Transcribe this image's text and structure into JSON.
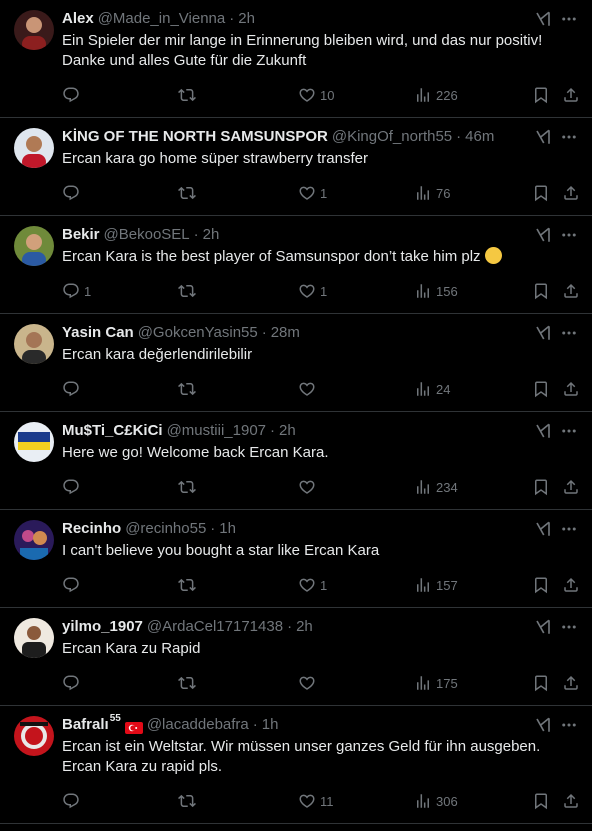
{
  "colors": {
    "background": "#000000",
    "text": "#e7e9ea",
    "muted": "#71767b",
    "divider": "#2f3336"
  },
  "icons": {
    "reply": "reply-icon",
    "retweet": "retweet-icon",
    "like": "heart-icon",
    "views": "views-icon",
    "bookmark": "bookmark-icon",
    "share": "share-icon",
    "grok": "grok-icon",
    "more": "more-icon"
  },
  "tweets": [
    {
      "name": "Alex",
      "handle": "@Made_in_Vienna",
      "sep": "·",
      "time": "2h",
      "text": "Ein Spieler der mir lange in Erinnerung bleiben wird, und das nur positiv! Danke und alles Gute für die Zukunft",
      "replies": "",
      "retweets": "",
      "likes": "10",
      "views": "226"
    },
    {
      "name": "KİNG OF THE NORTH SAMSUNSPOR",
      "handle": "@KingOf_north55",
      "sep": "·",
      "time": "46m",
      "text": "Ercan kara go home süper strawberry transfer",
      "replies": "",
      "retweets": "",
      "likes": "1",
      "views": "76"
    },
    {
      "name": "Bekir",
      "handle": "@BekooSEL",
      "sep": "·",
      "time": "2h",
      "text": "Ercan Kara is the best player of Samsunspor don’t take him plz",
      "replies": "1",
      "retweets": "",
      "likes": "1",
      "views": "156"
    },
    {
      "name": "Yasin Can",
      "handle": "@GokcenYasin55",
      "sep": "·",
      "time": "28m",
      "text": "Ercan kara değerlendirilebilir",
      "replies": "",
      "retweets": "",
      "likes": "",
      "views": "24"
    },
    {
      "name": "Mu$Ti_C£KiCi",
      "handle": "@mustiii_1907",
      "sep": "·",
      "time": "2h",
      "text": "Here we go! Welcome back Ercan Kara.",
      "replies": "",
      "retweets": "",
      "likes": "",
      "views": "234"
    },
    {
      "name": "Recinho",
      "handle": "@recinho55",
      "sep": "·",
      "time": "1h",
      "text": "I can't believe you bought a star like Ercan Kara",
      "replies": "",
      "retweets": "",
      "likes": "1",
      "views": "157"
    },
    {
      "name": "yilmo_1907",
      "handle": "@ArdaCel17171438",
      "sep": "·",
      "time": "2h",
      "text": "Ercan Kara zu Rapid",
      "replies": "",
      "retweets": "",
      "likes": "",
      "views": "175"
    },
    {
      "name": "Bafralı",
      "name_sup": "55",
      "handle": "@lacaddebafra",
      "sep": "·",
      "time": "1h",
      "text": "Ercan ist ein Weltstar. Wir müssen unser ganzes Geld für ihn ausgeben. Ercan Kara zu rapid pls.",
      "replies": "",
      "retweets": "",
      "likes": "11",
      "views": "306"
    }
  ]
}
